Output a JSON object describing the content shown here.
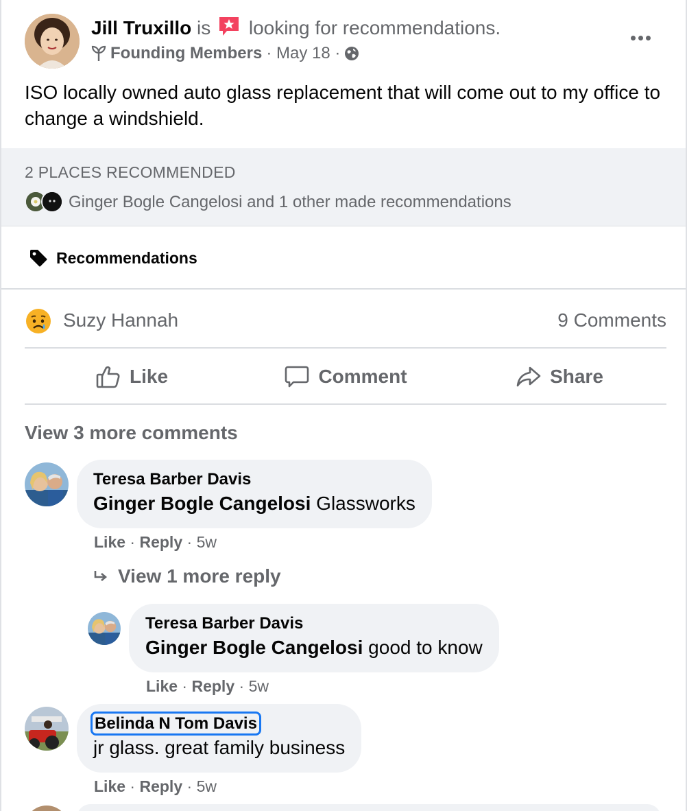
{
  "post": {
    "author": "Jill Truxillo",
    "verb": "is",
    "feeling_text": "looking for recommendations.",
    "group": "Founding Members",
    "date": "· May 18 ·",
    "text": "ISO locally owned auto glass replacement that will come out to my office to change a windshield.",
    "icons": [
      "feeling-star-icon",
      "group-sprout-icon",
      "globe-icon",
      "more-options-icon"
    ]
  },
  "recommendations": {
    "count_label": "2 PLACES RECOMMENDED",
    "people_text": "Ginger Bogle Cangelosi and 1 other made recommendations",
    "tab_label": "Recommendations"
  },
  "reactions": {
    "reactor": "Suzy Hannah",
    "comments_count": "9 Comments",
    "reaction_icon": "sad-emoji-icon"
  },
  "actions": {
    "like": "Like",
    "comment": "Comment",
    "share": "Share"
  },
  "view_more_comments": "View 3 more comments",
  "comments": [
    {
      "author": "Teresa Barber Davis",
      "tagged": "Ginger Bogle Cangelosi",
      "text": "Glassworks",
      "like": "Like",
      "reply": "Reply",
      "age": "5w"
    },
    {
      "author": "Belinda N Tom Davis",
      "text": "jr glass. great family business",
      "like": "Like",
      "reply": "Reply",
      "age": "5w"
    }
  ],
  "reply_thread": {
    "view_label": "View 1 more reply",
    "reply": {
      "author": "Teresa Barber Davis",
      "tagged": "Ginger Bogle Cangelosi",
      "text": "good to know",
      "like": "Like",
      "reply": "Reply",
      "age": "5w"
    }
  },
  "colors": {
    "primary_text": "#050505",
    "secondary_text": "#65676b",
    "bubble_bg": "#f0f2f5",
    "focus_outline": "#1877f2"
  }
}
